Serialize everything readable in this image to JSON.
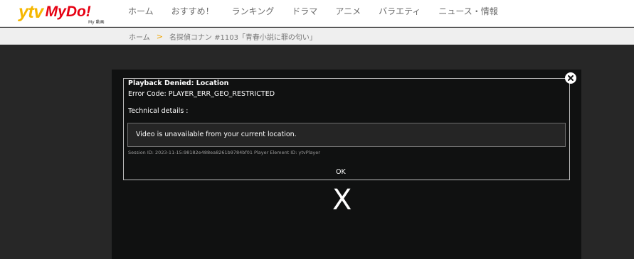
{
  "header": {
    "logo": {
      "ytv": "ytv",
      "mydo": "MyDo!",
      "sub": "My 動画"
    },
    "nav": [
      "ホーム",
      "おすすめ！",
      "ランキング",
      "ドラマ",
      "アニメ",
      "バラエティ",
      "ニュース・情報"
    ]
  },
  "breadcrumb": {
    "home": "ホーム",
    "separator": ">",
    "current": "名探偵コナン #1103「青春小説に罪の匂い」"
  },
  "dialog": {
    "title": "Playback Denied: Location",
    "error_code": "Error Code: PLAYER_ERR_GEO_RESTRICTED",
    "technical_label": "Technical details :",
    "message": "Video is unavailable from your current location.",
    "session": "Session ID: 2023-11-15:98182e488ea8261b9784bf01 Player Element ID: ytvPlayer",
    "ok_label": "OK",
    "close_icon": "close-icon"
  },
  "player": {
    "big_x": "X"
  },
  "colors": {
    "brand_yellow": "#f5b700",
    "brand_red": "#e60012",
    "crumb_separator": "#f0a500",
    "player_bg": "#101111",
    "page_bg": "#272727"
  }
}
